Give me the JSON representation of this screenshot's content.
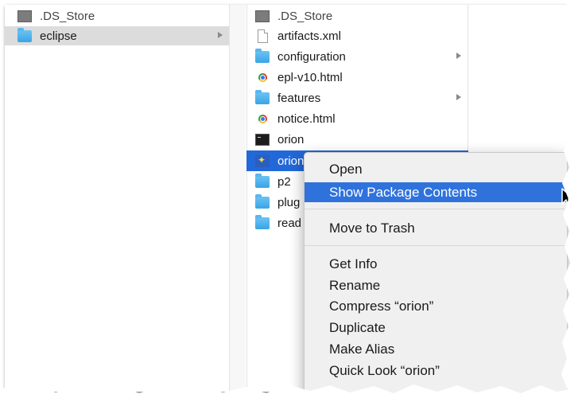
{
  "left_column": {
    "items": [
      {
        "label": ".DS_Store",
        "icon": "ds-store-icon"
      },
      {
        "label": "eclipse",
        "icon": "folder-icon",
        "selected": true,
        "has_children": true
      }
    ]
  },
  "middle_column": {
    "items": [
      {
        "label": ".DS_Store",
        "icon": "ds-store-icon"
      },
      {
        "label": "artifacts.xml",
        "icon": "document-icon"
      },
      {
        "label": "configuration",
        "icon": "folder-icon",
        "has_children": true
      },
      {
        "label": "epl-v10.html",
        "icon": "chrome-html-icon"
      },
      {
        "label": "features",
        "icon": "folder-icon",
        "has_children": true
      },
      {
        "label": "notice.html",
        "icon": "chrome-html-icon"
      },
      {
        "label": "orion",
        "icon": "terminal-exec-icon"
      },
      {
        "label": "orion",
        "icon": "app-icon",
        "selected": true
      },
      {
        "label": "p2",
        "icon": "folder-icon"
      },
      {
        "label": "plug",
        "icon": "folder-icon"
      },
      {
        "label": "read",
        "icon": "folder-icon"
      }
    ]
  },
  "context_menu": {
    "open": "Open",
    "show_package_contents": "Show Package Contents",
    "move_to_trash": "Move to Trash",
    "get_info": "Get Info",
    "rename": "Rename",
    "compress": "Compress “orion”",
    "duplicate": "Duplicate",
    "make_alias": "Make Alias",
    "quick_look": "Quick Look “orion”"
  },
  "colors": {
    "selection_blue": "#2268d8",
    "menu_highlight": "#2f72dc",
    "folder": "#4fb3ee"
  }
}
